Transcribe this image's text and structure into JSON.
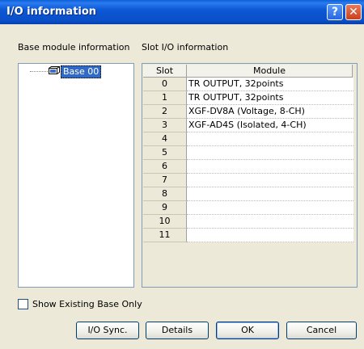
{
  "window": {
    "title": "I/O information",
    "help_glyph": "?",
    "close_glyph": "✕"
  },
  "labels": {
    "base_module": "Base module information",
    "slot_io": "Slot I/O information"
  },
  "tree": {
    "base_item": "Base 00"
  },
  "table": {
    "headers": [
      "Slot",
      "Module"
    ],
    "rows": [
      {
        "slot": "0",
        "module": "TR OUTPUT, 32points"
      },
      {
        "slot": "1",
        "module": "TR OUTPUT, 32points"
      },
      {
        "slot": "2",
        "module": "XGF-DV8A (Voltage, 8-CH)"
      },
      {
        "slot": "3",
        "module": "XGF-AD4S (Isolated, 4-CH)"
      },
      {
        "slot": "4",
        "module": ""
      },
      {
        "slot": "5",
        "module": ""
      },
      {
        "slot": "6",
        "module": ""
      },
      {
        "slot": "7",
        "module": ""
      },
      {
        "slot": "8",
        "module": ""
      },
      {
        "slot": "9",
        "module": ""
      },
      {
        "slot": "10",
        "module": ""
      },
      {
        "slot": "11",
        "module": ""
      }
    ]
  },
  "checkbox": {
    "label": "Show Existing Base Only",
    "checked": false
  },
  "buttons": {
    "io_sync": "I/O Sync.",
    "details": "Details",
    "ok": "OK",
    "cancel": "Cancel"
  },
  "colors": {
    "titlebar": "#0a4fc8",
    "selection": "#316ac5",
    "face": "#ece9d8"
  }
}
